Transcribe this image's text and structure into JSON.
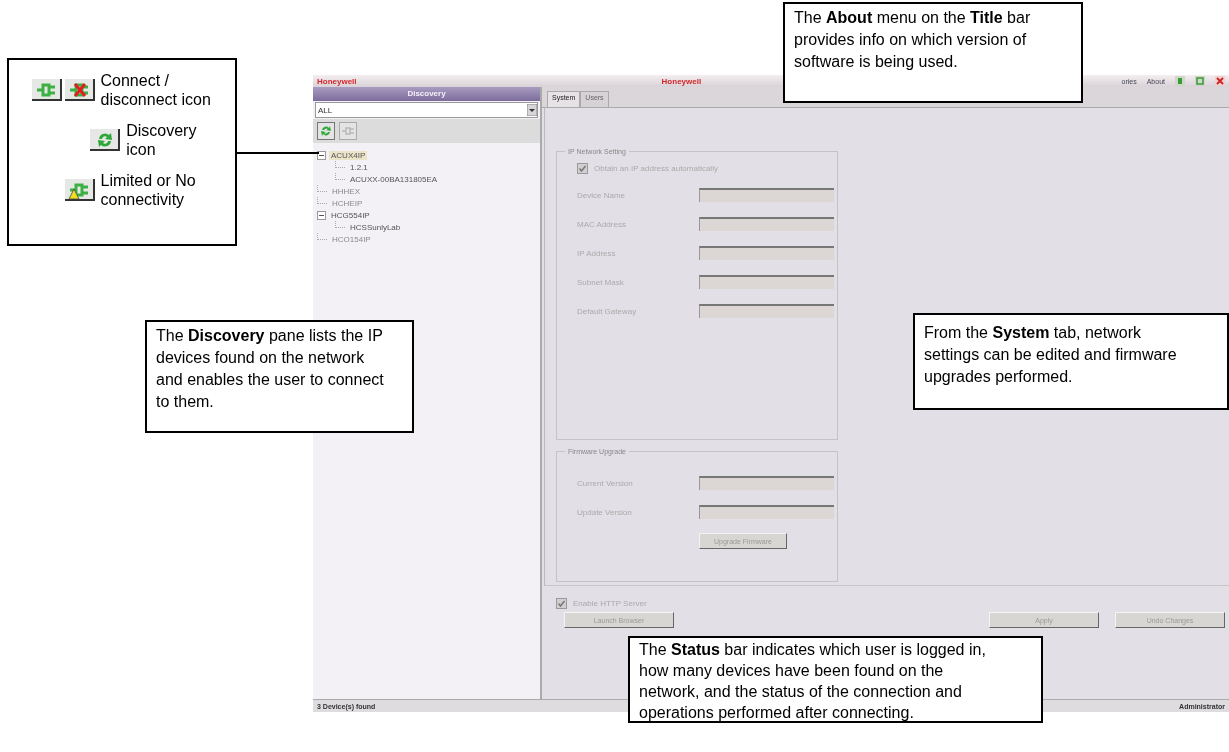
{
  "title_bar": {
    "brand": "Honeywell",
    "center_brand": "Honeywell",
    "menus": [
      "ories",
      "About"
    ]
  },
  "discovery": {
    "header": "Discovery",
    "filter": "ALL",
    "tree": [
      {
        "label": "ACUX4IP",
        "online": true,
        "selected": true,
        "expanded": true,
        "children": [
          {
            "label": "1.2.1",
            "online": true,
            "selected": false
          },
          {
            "label": "ACUXX-00BA131805EA",
            "online": true,
            "selected": false
          }
        ]
      },
      {
        "label": "HHHEX",
        "online": false,
        "selected": false
      },
      {
        "label": "HCHEIP",
        "online": false,
        "selected": false
      },
      {
        "label": "HCG554IP",
        "online": true,
        "selected": false,
        "expanded": true,
        "children": [
          {
            "label": "HCSSunlyLab",
            "online": true,
            "selected": false
          }
        ]
      },
      {
        "label": "HCO154IP",
        "online": false,
        "selected": false
      }
    ]
  },
  "tabs": [
    {
      "label": "System",
      "selected": true
    },
    {
      "label": "Users",
      "selected": false
    }
  ],
  "ip_settings": {
    "legend": "IP Network Setting",
    "auto_ip": {
      "label": "Obtain an IP address automatically",
      "checked": true
    },
    "fields": [
      {
        "label": "Device Name"
      },
      {
        "label": "MAC Address"
      },
      {
        "label": "IP Address"
      },
      {
        "label": "Subnet Mask"
      },
      {
        "label": "Default Gateway"
      }
    ]
  },
  "firmware": {
    "legend": "Firmware Upgrade",
    "fields": [
      {
        "label": "Current Version"
      },
      {
        "label": "Update Version"
      }
    ],
    "button": "Upgrade Firmware"
  },
  "http_server": {
    "label": "Enable HTTP Server",
    "checked": true
  },
  "buttons": {
    "launch": "Launch Browser",
    "apply": "Apply",
    "undo": "Undo Changes"
  },
  "status_bar": {
    "left": "3 Device(s) found",
    "right": "Administrator"
  },
  "legend_box": {
    "items": [
      {
        "icons": [
          {
            "kind": "connect"
          },
          {
            "kind": "disconnect"
          }
        ],
        "label": "Connect / disconnect icon"
      },
      {
        "icons": [
          {
            "kind": "discovery"
          }
        ],
        "label": "Discovery icon"
      },
      {
        "icons": [
          {
            "kind": "limited"
          }
        ],
        "label": "Limited or No connectivity"
      }
    ]
  },
  "callouts": [
    {
      "kind": "about",
      "text": "The **About** menu on the **Title** bar provides info on which version of software is being used."
    },
    {
      "kind": "discovery",
      "text": "The **Discovery** pane lists the IP devices found on the network and enables the user to connect to them."
    },
    {
      "kind": "system",
      "text": "From the **System** tab, network settings can be edited and firmware upgrades performed."
    },
    {
      "kind": "status",
      "text": "The **Status** bar indicates which user is logged in, how many devices have been found on the network, and the status of the connection and operations performed after connecting."
    }
  ]
}
